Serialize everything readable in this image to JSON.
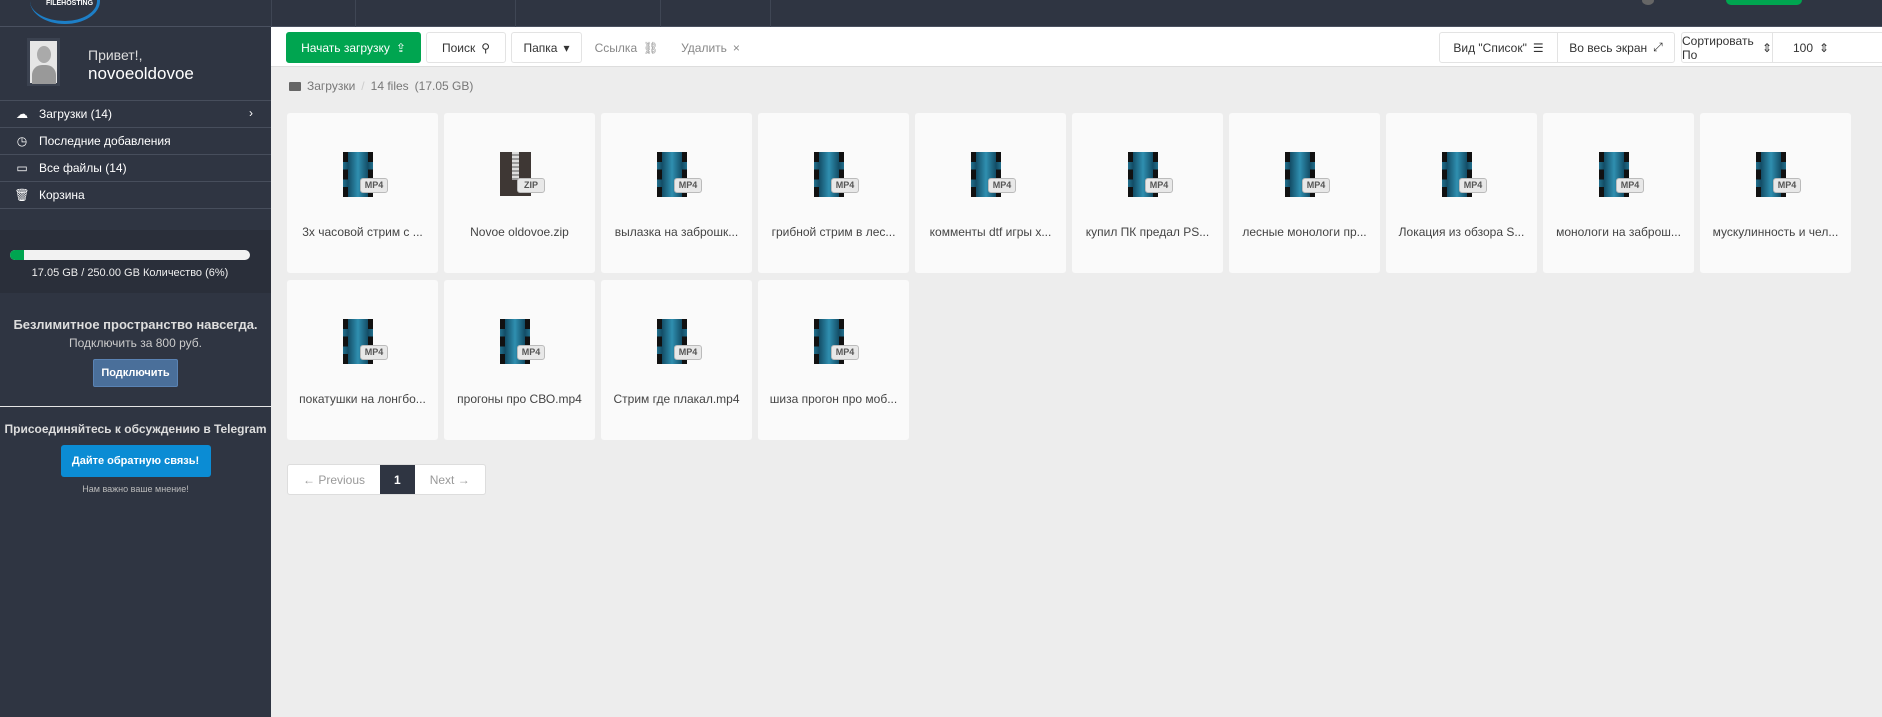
{
  "header": {
    "logo_text": "FILEHOSTING"
  },
  "user": {
    "greeting": "Привет!,",
    "username": "novoeoldovoe"
  },
  "sidebar": {
    "items": [
      {
        "label": "Загрузки (14)",
        "icon": "cloud-upload-icon",
        "has_chevron": true
      },
      {
        "label": "Последние добавления",
        "icon": "clock-icon"
      },
      {
        "label": "Все файлы (14)",
        "icon": "drive-icon"
      },
      {
        "label": "Корзина",
        "icon": "trash-icon"
      }
    ],
    "storage": {
      "text": "17.05 GB / 250.00 GB Количество (6%)",
      "percent": 6
    },
    "promo": {
      "title": "Безлимитное пространство навсегда.",
      "subtitle": "Подключить за 800 руб.",
      "button": "Подключить"
    },
    "telegram": {
      "title": "Присоединяйтесь к обсуждению в Telegram",
      "button": "Дайте обратную связь!",
      "note": "Нам важно ваше мнение!"
    }
  },
  "toolbar": {
    "upload": "Начать загрузку",
    "search": "Поиск",
    "folder": "Папка",
    "link": "Ссылка",
    "delete": "Удалить",
    "view": "Вид \"Список\"",
    "fullscreen": "Во весь экран",
    "sort": "Сортировать По",
    "per_page": "100"
  },
  "breadcrumb": {
    "root": "Загрузки",
    "count": "14 files",
    "size": "(17.05 GB)"
  },
  "files": [
    {
      "name": "3х часовой стрим с ...",
      "type": "MP4"
    },
    {
      "name": "Novoe oldovoe.zip",
      "type": "ZIP"
    },
    {
      "name": "вылазка на заброшк...",
      "type": "MP4"
    },
    {
      "name": "грибной стрим в лес...",
      "type": "MP4"
    },
    {
      "name": "комменты dtf игры х...",
      "type": "MP4"
    },
    {
      "name": "купил ПК предал PS...",
      "type": "MP4"
    },
    {
      "name": "лесные монологи пр...",
      "type": "MP4"
    },
    {
      "name": "Локация из обзора S...",
      "type": "MP4"
    },
    {
      "name": "монологи на заброш...",
      "type": "MP4"
    },
    {
      "name": "мускулинность и чел...",
      "type": "MP4"
    },
    {
      "name": "покатушки на лонгбо...",
      "type": "MP4"
    },
    {
      "name": "прогоны про СВО.mp4",
      "type": "MP4"
    },
    {
      "name": "Стрим где плакал.mp4",
      "type": "MP4"
    },
    {
      "name": "шиза прогон про моб...",
      "type": "MP4"
    }
  ],
  "pagination": {
    "prev": "← Previous",
    "current": "1",
    "next": "Next →"
  }
}
